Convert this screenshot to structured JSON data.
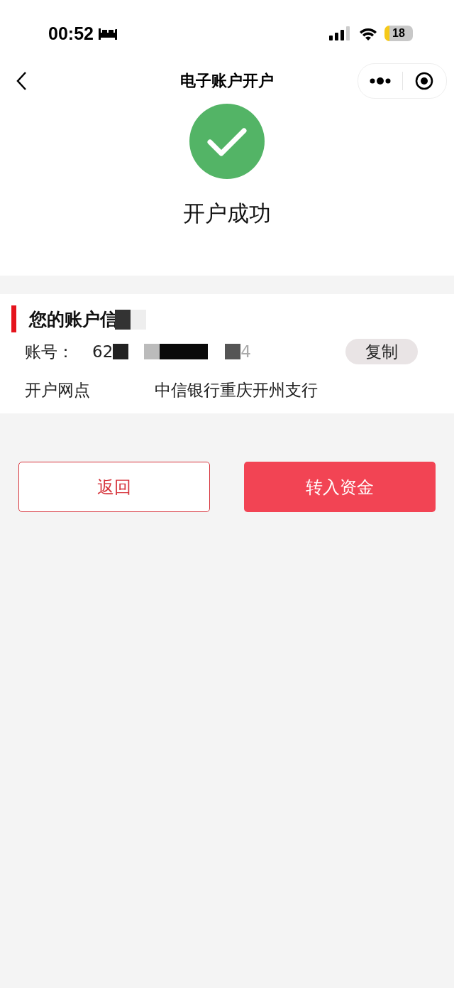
{
  "status_bar": {
    "time": "00:52",
    "battery": "18"
  },
  "nav_bar": {
    "title": "电子账户开户"
  },
  "result": {
    "message": "开户成功"
  },
  "account_info": {
    "title": "您的账户信",
    "rows": [
      {
        "kind": "account",
        "label": "账号：",
        "value_start": "62",
        "value_end": "4",
        "action": "复制"
      },
      {
        "kind": "plain",
        "label": "开户网点",
        "value": "中信银行重庆开州支行"
      }
    ]
  },
  "buttons": [
    {
      "label": "返回",
      "kind": "secondary"
    },
    {
      "label": "转入资金",
      "kind": "primary"
    }
  ]
}
